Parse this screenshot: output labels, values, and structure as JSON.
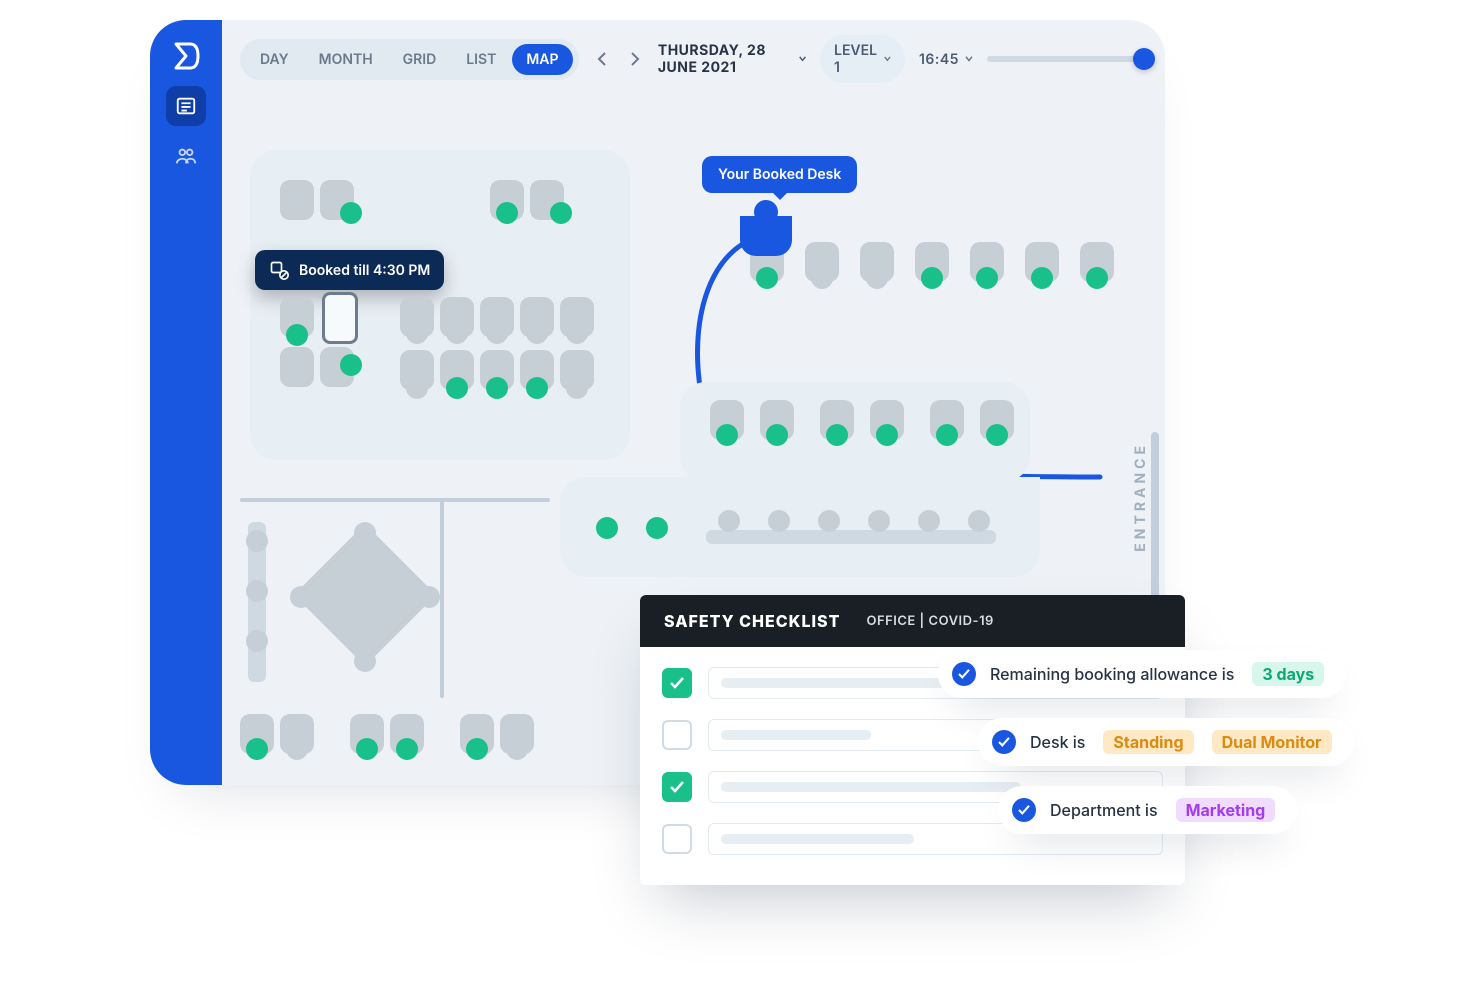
{
  "toolbar": {
    "views": [
      "DAY",
      "MONTH",
      "GRID",
      "LIST",
      "MAP"
    ],
    "active_view_index": 4,
    "date_label": "THURSDAY, 28 JUNE 2021",
    "level_label": "LEVEL 1",
    "time_label": "16:45"
  },
  "map": {
    "booked_tooltip": "Booked till 4:30 PM",
    "your_desk_label": "Your Booked Desk",
    "entrance_label": "ENTRANCE"
  },
  "safety": {
    "title": "SAFETY CHECKLIST",
    "subtitle": "OFFICE | COVID-19",
    "items": [
      true,
      false,
      true,
      false
    ]
  },
  "info_pills": {
    "allowance_prefix": "Remaining booking allowance is",
    "allowance_value": "3 days",
    "desk_prefix": "Desk is",
    "desk_tags": [
      "Standing",
      "Dual Monitor"
    ],
    "dept_prefix": "Department is",
    "dept_value": "Marketing"
  },
  "colors": {
    "available": "#19c08a",
    "unavailable": "#c6ced6",
    "accent": "#1a57e0"
  }
}
